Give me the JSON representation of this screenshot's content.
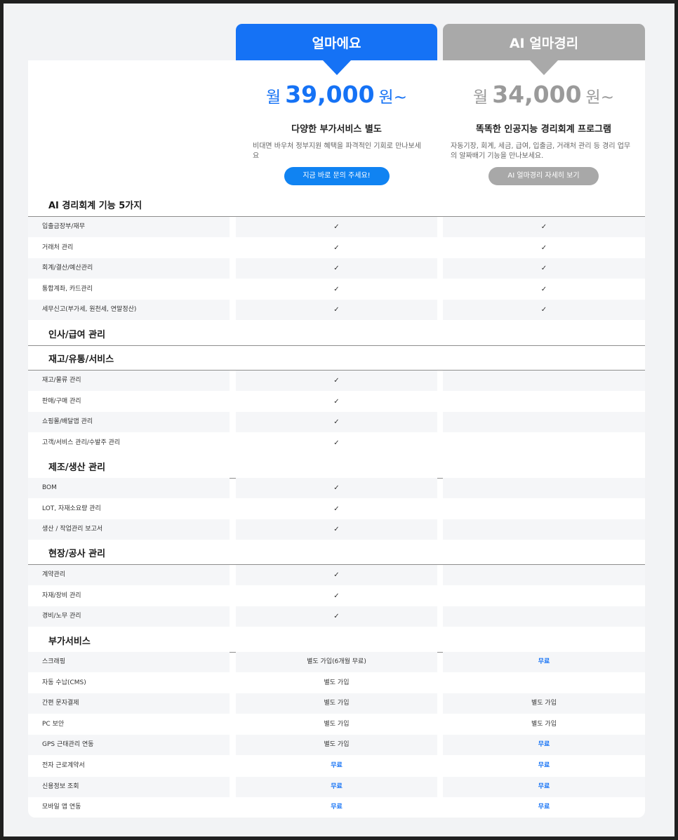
{
  "plans": [
    {
      "name": "얼마에요",
      "price_prefix": "월",
      "price": "39,000",
      "price_suffix": "원~",
      "title": "다양한 부가서비스 별도",
      "desc": "비대면 바우처 정부지원 혜택을 파격적인 기회로 만나보세요",
      "button": "지금 바로 문의 주세요!"
    },
    {
      "name": "AI 얼마경리",
      "price_prefix": "월",
      "price": "34,000",
      "price_suffix": "원~",
      "title": "똑똑한 인공지능 경리회계 프로그램",
      "desc": "자동기장, 회계, 세금, 급여, 입출금, 거래처 관리 등 경리 업무의 알짜배기 기능을 만나보세요.",
      "button": "AI 얼마경리 자세히 보기"
    }
  ],
  "check_glyph": "✓",
  "colors": {
    "accent": "#1572f5",
    "secondary": "#a9a9a9"
  },
  "sections": [
    {
      "title": "AI 경리회계 기능 5가지",
      "rows": [
        {
          "label": "입출금장부/재무",
          "c1": "check",
          "c2": "check"
        },
        {
          "label": "거래처 관리",
          "c1": "check",
          "c2": "check"
        },
        {
          "label": "회계/결산/예산관리",
          "c1": "check",
          "c2": "check"
        },
        {
          "label": "통합계좌, 카드관리",
          "c1": "check",
          "c2": "check"
        },
        {
          "label": "세무신고(부가세, 원천세, 연말정산)",
          "c1": "check",
          "c2": "check"
        }
      ]
    },
    {
      "title": "인사/급여 관리",
      "rows": []
    },
    {
      "title": "재고/유통/서비스",
      "rows": [
        {
          "label": "재고/물류 관리",
          "c1": "check",
          "c2": ""
        },
        {
          "label": "판매/구매 관리",
          "c1": "check",
          "c2": ""
        },
        {
          "label": "쇼핑몰/배달앱 관리",
          "c1": "check",
          "c2": ""
        },
        {
          "label": "고객/서비스 관리/수발주 관리",
          "c1": "check",
          "c2": ""
        }
      ]
    },
    {
      "title": "제조/생산 관리",
      "rows": [
        {
          "label": "BOM",
          "c1": "check",
          "c2": ""
        },
        {
          "label": "LOT, 자재소요량 관리",
          "c1": "check",
          "c2": ""
        },
        {
          "label": "생산 / 작업관리 보고서",
          "c1": "check",
          "c2": ""
        }
      ]
    },
    {
      "title": "현장/공사 관리",
      "rows": [
        {
          "label": "계약관리",
          "c1": "check",
          "c2": ""
        },
        {
          "label": "자재/장비 관리",
          "c1": "check",
          "c2": ""
        },
        {
          "label": "경비/노무 관리",
          "c1": "check",
          "c2": ""
        }
      ]
    },
    {
      "title": "부가서비스",
      "rows": [
        {
          "label": "스크래핑",
          "c1": "별도 가입(6개월 무료)",
          "c2": "free:무료"
        },
        {
          "label": "자동 수납(CMS)",
          "c1": "별도 가입",
          "c2": ""
        },
        {
          "label": "간편 문자결제",
          "c1": "별도 가입",
          "c2": "별도 가입"
        },
        {
          "label": "PC 보안",
          "c1": "별도 가입",
          "c2": "별도 가입"
        },
        {
          "label": "GPS 근태관리 연동",
          "c1": "별도 가입",
          "c2": "free:무료"
        },
        {
          "label": "전자 근로계약서",
          "c1": "free:무료",
          "c2": "free:무료"
        },
        {
          "label": "신용정보 조회",
          "c1": "free:무료",
          "c2": "free:무료"
        },
        {
          "label": "모바일 앱 연동",
          "c1": "free:무료",
          "c2": "free:무료"
        }
      ]
    }
  ]
}
